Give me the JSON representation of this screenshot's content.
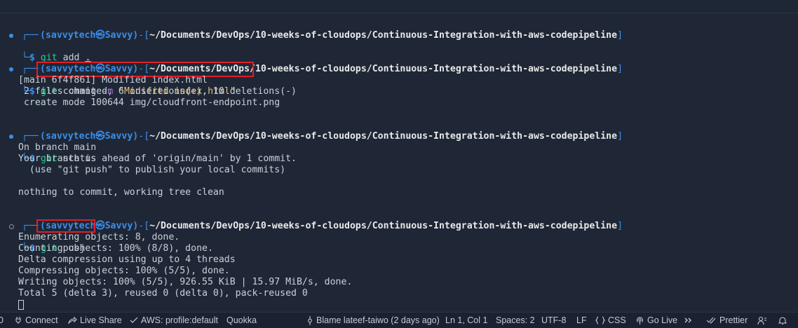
{
  "terminal": {
    "prompt": {
      "corner_top": "┌──",
      "corner_bottom": "└─",
      "user_host": "(savvytech㉿Savvy)",
      "dash": "-",
      "path_open": "[",
      "path": "~/Documents/DevOps/10-weeks-of-cloudops/Continuous-Integration-with-aws-codepipeline",
      "path_close": "]",
      "dollar": "$"
    },
    "blocks": [
      {
        "command": "git",
        "args": " add ",
        "extra": "."
      },
      {
        "command": "git",
        "args": " commit ",
        "flag": "-m",
        "string": " \"Modified index.html\""
      },
      {
        "command": "git",
        "args": " status"
      },
      {
        "command": "git",
        "args": " push"
      }
    ],
    "commit_output": [
      "[main 6f4f861] Modified index.html",
      " 2 files changed, 6 insertions(+), 10 deletions(-)",
      " create mode 100644 img/cloudfront-endpoint.png"
    ],
    "status_output": [
      "On branch main",
      "Your branch is ahead of 'origin/main' by 1 commit.",
      "  (use \"git push\" to publish your local commits)",
      "",
      "nothing to commit, working tree clean"
    ],
    "push_output": [
      "Enumerating objects: 8, done.",
      "Counting objects: 100% (8/8), done.",
      "Delta compression using up to 4 threads",
      "Compressing objects: 100% (5/5), done.",
      "Writing objects: 100% (5/5), 926.55 KiB | 15.97 MiB/s, done.",
      "Total 5 (delta 3), reused 0 (delta 0), pack-reused 0"
    ]
  },
  "statusbar": {
    "problems": "0",
    "connect": "Connect",
    "live_share": "Live Share",
    "aws": "AWS: profile:default",
    "quokka": "Quokka",
    "blame": "Blame lateef-taiwo (2 days ago)",
    "position": "Ln 1, Col 1",
    "spaces": "Spaces: 2",
    "encoding": "UTF-8",
    "eol": "LF",
    "language": "CSS",
    "go_live": "Go Live",
    "prettier": "Prettier"
  },
  "colors": {
    "background": "#1f2736",
    "prompt_blue": "#3b8eea",
    "command_green": "#23d18b",
    "highlight_red": "#e11d2a"
  }
}
